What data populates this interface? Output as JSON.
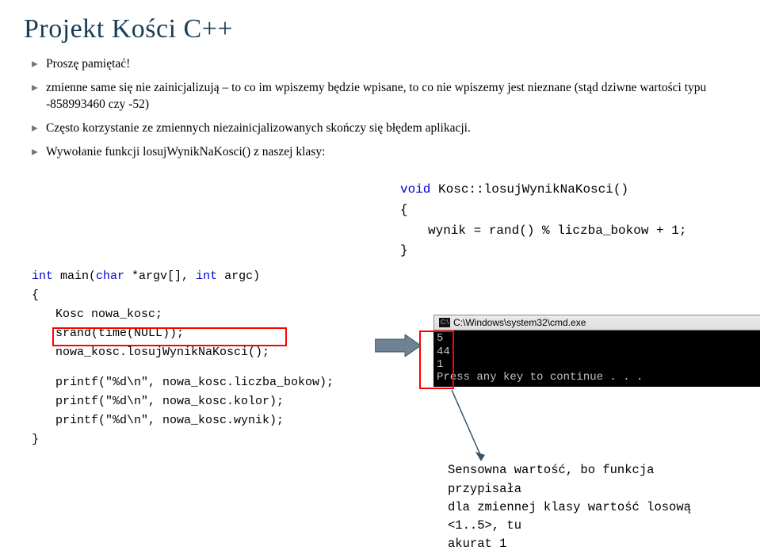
{
  "title": "Projekt Kości C++",
  "bullets": [
    "Proszę pamiętać!",
    "zmienne same się nie zainicjalizują – to co im wpiszemy będzie wpisane, to co nie wpiszemy jest nieznane (stąd dziwne wartości typu -858993460 czy -52)",
    "Często korzystanie ze zmiennych niezainicjalizowanych skończy się błędem aplikacji.",
    "Wywołanie funkcji losujWynikNaKosci() z naszej klasy:"
  ],
  "code_left": {
    "l1_kw": "int",
    "l1_rest": " main(",
    "l1_kw2": "char",
    "l1_rest2": " *argv[], ",
    "l1_kw3": "int",
    "l1_rest3": " argc)",
    "l2": "{",
    "l3": "Kosc nowa_kosc;",
    "l4": "srand(time(NULL));",
    "l5": "nowa_kosc.losujWynikNaKosci();",
    "l6": "printf(\"%d\\n\", nowa_kosc.liczba_bokow);",
    "l7": "printf(\"%d\\n\", nowa_kosc.kolor);",
    "l8": "printf(\"%d\\n\", nowa_kosc.wynik);",
    "l9": "}"
  },
  "code_right": {
    "r1_kw": "void",
    "r1_rest": " Kosc::losujWynikNaKosci()",
    "r2": "{",
    "r3": "wynik = rand() % liczba_bokow + 1;",
    "r4": "}"
  },
  "cmd": {
    "title": "C:\\Windows\\system32\\cmd.exe",
    "icon": "C:\\",
    "line1": "5",
    "line2": "44",
    "line3": "1",
    "line4": "Press any key to continue . . ."
  },
  "caption": {
    "l1": "Sensowna wartość, bo funkcja przypisała",
    "l2": "dla zmiennej klasy wartość losową <1..5>, tu",
    "l3": "akurat 1"
  }
}
